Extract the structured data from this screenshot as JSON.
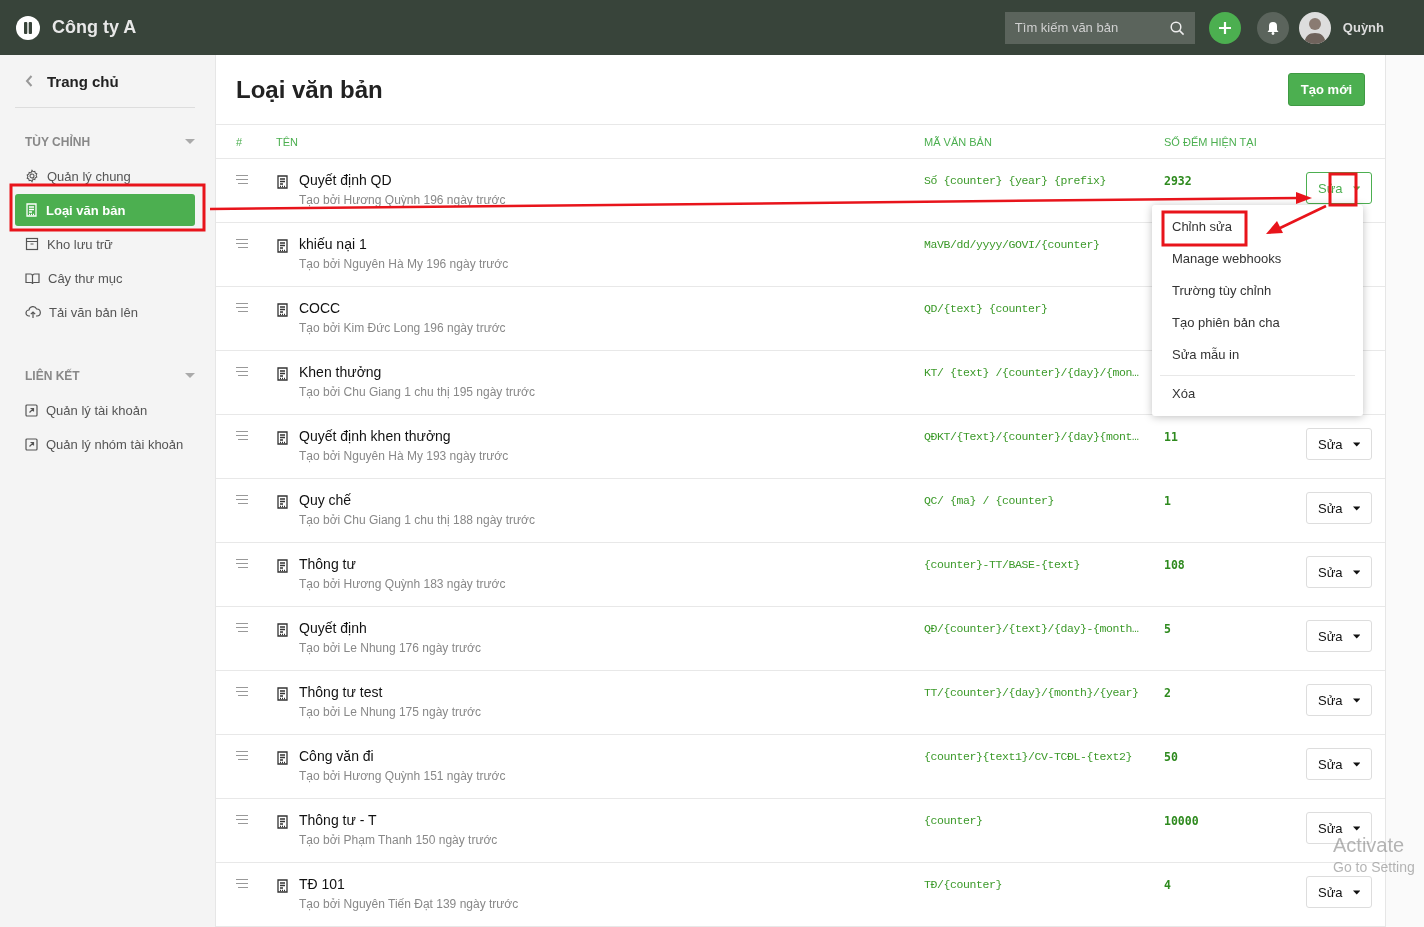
{
  "topbar": {
    "company": "Công ty A",
    "search": {
      "placeholder": "Tìm kiếm văn bản"
    },
    "user": "Quỳnh"
  },
  "sidebar": {
    "home": "Trang chủ",
    "sections": [
      {
        "title": "TÙY CHỈNH",
        "expanded": true,
        "items": [
          {
            "label": "Quản lý chung",
            "selected": false
          },
          {
            "label": "Loại văn bản",
            "selected": true
          },
          {
            "label": "Kho lưu trữ",
            "selected": false
          },
          {
            "label": "Cây thư mục",
            "selected": false
          },
          {
            "label": "Tải văn bản lên",
            "selected": false
          }
        ]
      },
      {
        "title": "LIÊN KẾT",
        "expanded": true,
        "items": [
          {
            "label": "Quản lý tài khoản",
            "selected": false
          },
          {
            "label": "Quản lý nhóm tài khoản",
            "selected": false
          }
        ]
      }
    ]
  },
  "page": {
    "title": "Loại văn bản",
    "create_button": "Tạo mới"
  },
  "table": {
    "columns": [
      "#",
      "TÊN",
      "MÃ VĂN BẢN",
      "SỐ ĐẾM HIỆN TẠI"
    ],
    "rows": [
      {
        "name": "Quyết định QD",
        "meta": "Tạo bởi Hương Quỳnh 196 ngày trước",
        "code": "Số {counter} {year} {prefix}",
        "counter": "2932",
        "action": {
          "label": "Sửa",
          "open": true
        }
      },
      {
        "name": "khiếu nại 1",
        "meta": "Tạo bởi Nguyên Hà My 196 ngày trước",
        "code": "MaVB/dd/yyyy/GOVI/{counter}"
      },
      {
        "name": "COCC",
        "meta": "Tạo bởi Kim Đức Long 196 ngày trước",
        "code": "QD/{text} {counter}"
      },
      {
        "name": "Khen thưởng",
        "meta": "Tạo bởi Chu Giang 1 chu thị 195 ngày trước",
        "code": "KT/ {text} /{counter}/{day}/{mon…"
      },
      {
        "name": "Quyết định khen thưởng",
        "meta": "Tạo bởi Nguyên Hà My 193 ngày trước",
        "code": "QĐKT/{Text}/{counter}/{day}{mont…",
        "counter": "11",
        "action": {
          "label": "Sửa",
          "open": false
        }
      },
      {
        "name": "Quy chế",
        "meta": "Tạo bởi Chu Giang 1 chu thị 188 ngày trước",
        "code": "QC/ {ma} / {counter}",
        "counter": "1",
        "action": {
          "label": "Sửa",
          "open": false
        }
      },
      {
        "name": "Thông tư",
        "meta": "Tạo bởi Hương Quỳnh 183 ngày trước",
        "code": "{counter}-TT/BASE-{text}",
        "counter": "108",
        "action": {
          "label": "Sửa",
          "open": false
        }
      },
      {
        "name": "Quyết định",
        "meta": "Tạo bởi Le Nhung 176 ngày trước",
        "code": "QĐ/{counter}/{text}/{day}-{month…",
        "counter": "5",
        "action": {
          "label": "Sửa",
          "open": false
        }
      },
      {
        "name": "Thông tư test",
        "meta": "Tạo bởi Le Nhung 175 ngày trước",
        "code": "TT/{counter}/{day}/{month}/{year}",
        "counter": "2",
        "action": {
          "label": "Sửa",
          "open": false
        }
      },
      {
        "name": "Công văn đi",
        "meta": "Tạo bởi Hương Quỳnh 151 ngày trước",
        "code": "{counter}{text1}/CV-TCĐL-{text2}",
        "counter": "50",
        "action": {
          "label": "Sửa",
          "open": false
        }
      },
      {
        "name": "Thông tư - T",
        "meta": "Tạo bởi Phạm Thanh 150 ngày trước",
        "code": "{counter}",
        "counter": "10000",
        "action": {
          "label": "Sửa",
          "open": false
        }
      },
      {
        "name": "TĐ 101",
        "meta": "Tạo bởi Nguyên Tiến Đạt 139 ngày trước",
        "code": "TĐ/{counter}",
        "counter": "4",
        "action": {
          "label": "Sửa",
          "open": false
        }
      }
    ]
  },
  "dropdown": {
    "items": [
      {
        "label": "Chỉnh sửa",
        "kind": "item"
      },
      {
        "label": "Manage webhooks",
        "kind": "item"
      },
      {
        "label": "Trường tùy chỉnh",
        "kind": "item"
      },
      {
        "label": "Tạo phiên bản cha",
        "kind": "item"
      },
      {
        "label": "Sửa mẫu in",
        "kind": "item"
      },
      {
        "label": "Xóa",
        "kind": "separated"
      }
    ]
  },
  "annotations": [
    {
      "kind": "box"
    },
    {
      "kind": "box"
    },
    {
      "kind": "box"
    },
    {
      "kind": "arrow"
    },
    {
      "kind": "arrow"
    }
  ],
  "os_notice": {
    "title": "Activate",
    "subtitle": "Go to Setting"
  }
}
